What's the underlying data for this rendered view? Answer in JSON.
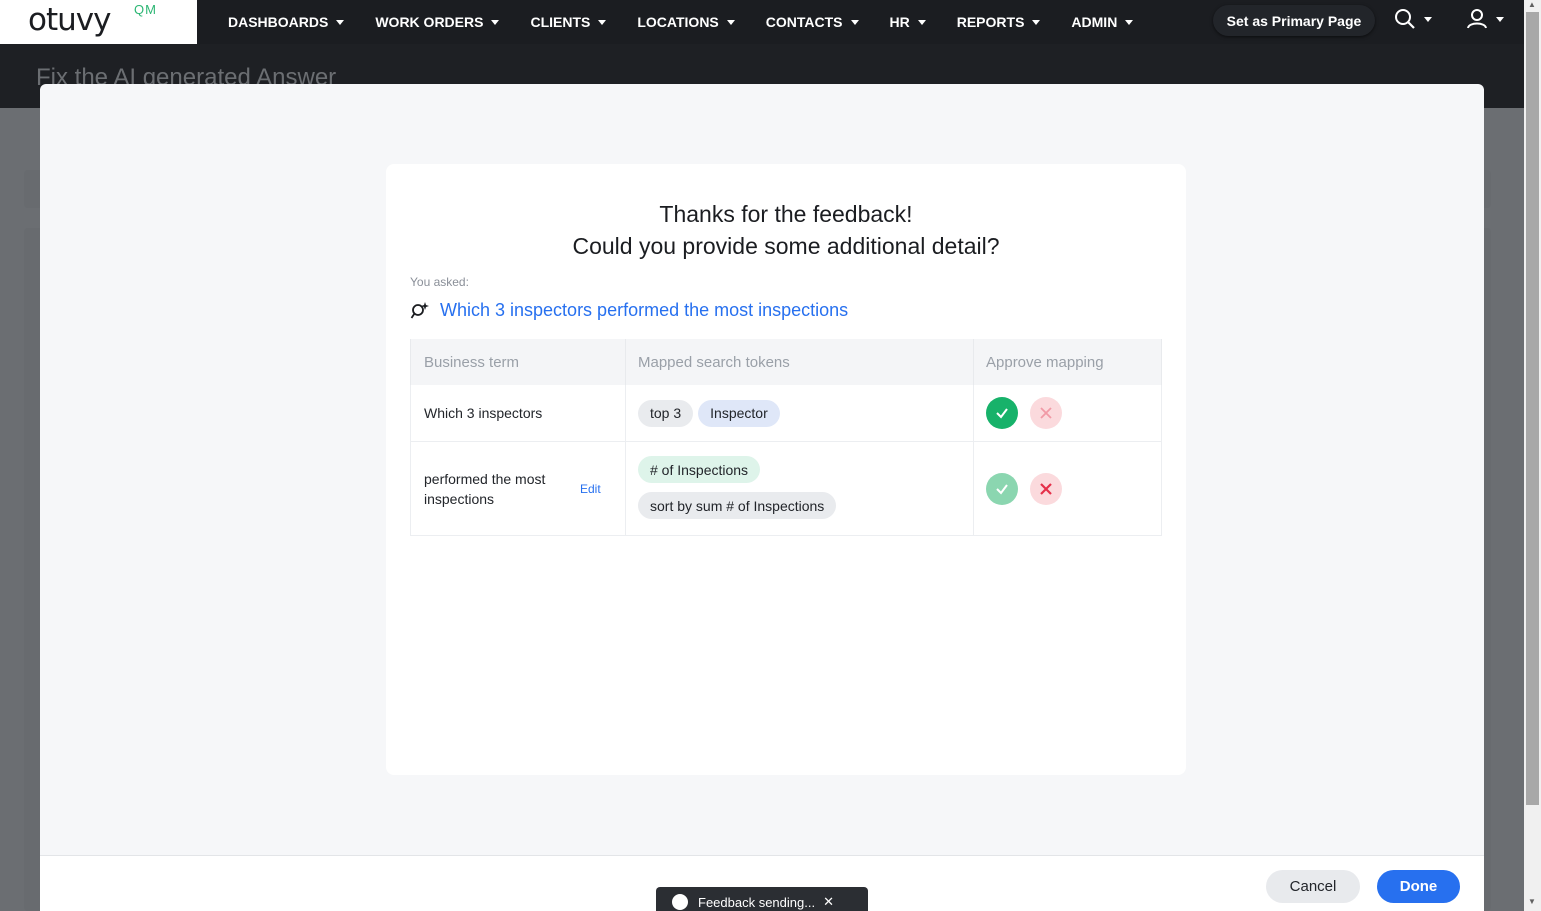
{
  "brand": {
    "logo_text": "otuvy",
    "logo_sup": "QM"
  },
  "nav": {
    "items": [
      {
        "label": "DASHBOARDS"
      },
      {
        "label": "WORK ORDERS"
      },
      {
        "label": "CLIENTS"
      },
      {
        "label": "LOCATIONS"
      },
      {
        "label": "CONTACTS"
      },
      {
        "label": "HR"
      },
      {
        "label": "REPORTS"
      },
      {
        "label": "ADMIN"
      }
    ],
    "primary_page_label": "Set as Primary Page",
    "icons": [
      "search-icon",
      "user-icon"
    ]
  },
  "background_page": {
    "title": "Fix the AI generated Answer"
  },
  "modal": {
    "heading_line1": "Thanks for the feedback!",
    "heading_line2": "Could you provide some additional detail?",
    "asked_label": "You asked:",
    "question": "Which 3 inspectors performed the most inspections",
    "columns": [
      "Business term",
      "Mapped search tokens",
      "Approve mapping"
    ],
    "rows": [
      {
        "term": "Which 3 inspectors",
        "tokens": [
          "top 3",
          "Inspector"
        ],
        "approve_state": "approved"
      },
      {
        "term": "performed the most inspections",
        "edit_label": "Edit",
        "tokens": [
          "# of Inspections",
          "sort by sum # of Inspections"
        ],
        "approve_state": "rejected"
      }
    ],
    "cancel_label": "Cancel",
    "done_label": "Done"
  },
  "toast": {
    "text": "Feedback sending..."
  },
  "colors": {
    "accent": "#2770ef",
    "approve": "#17b26a",
    "reject": "#e5304a",
    "nav_bg": "#1b1d21"
  }
}
